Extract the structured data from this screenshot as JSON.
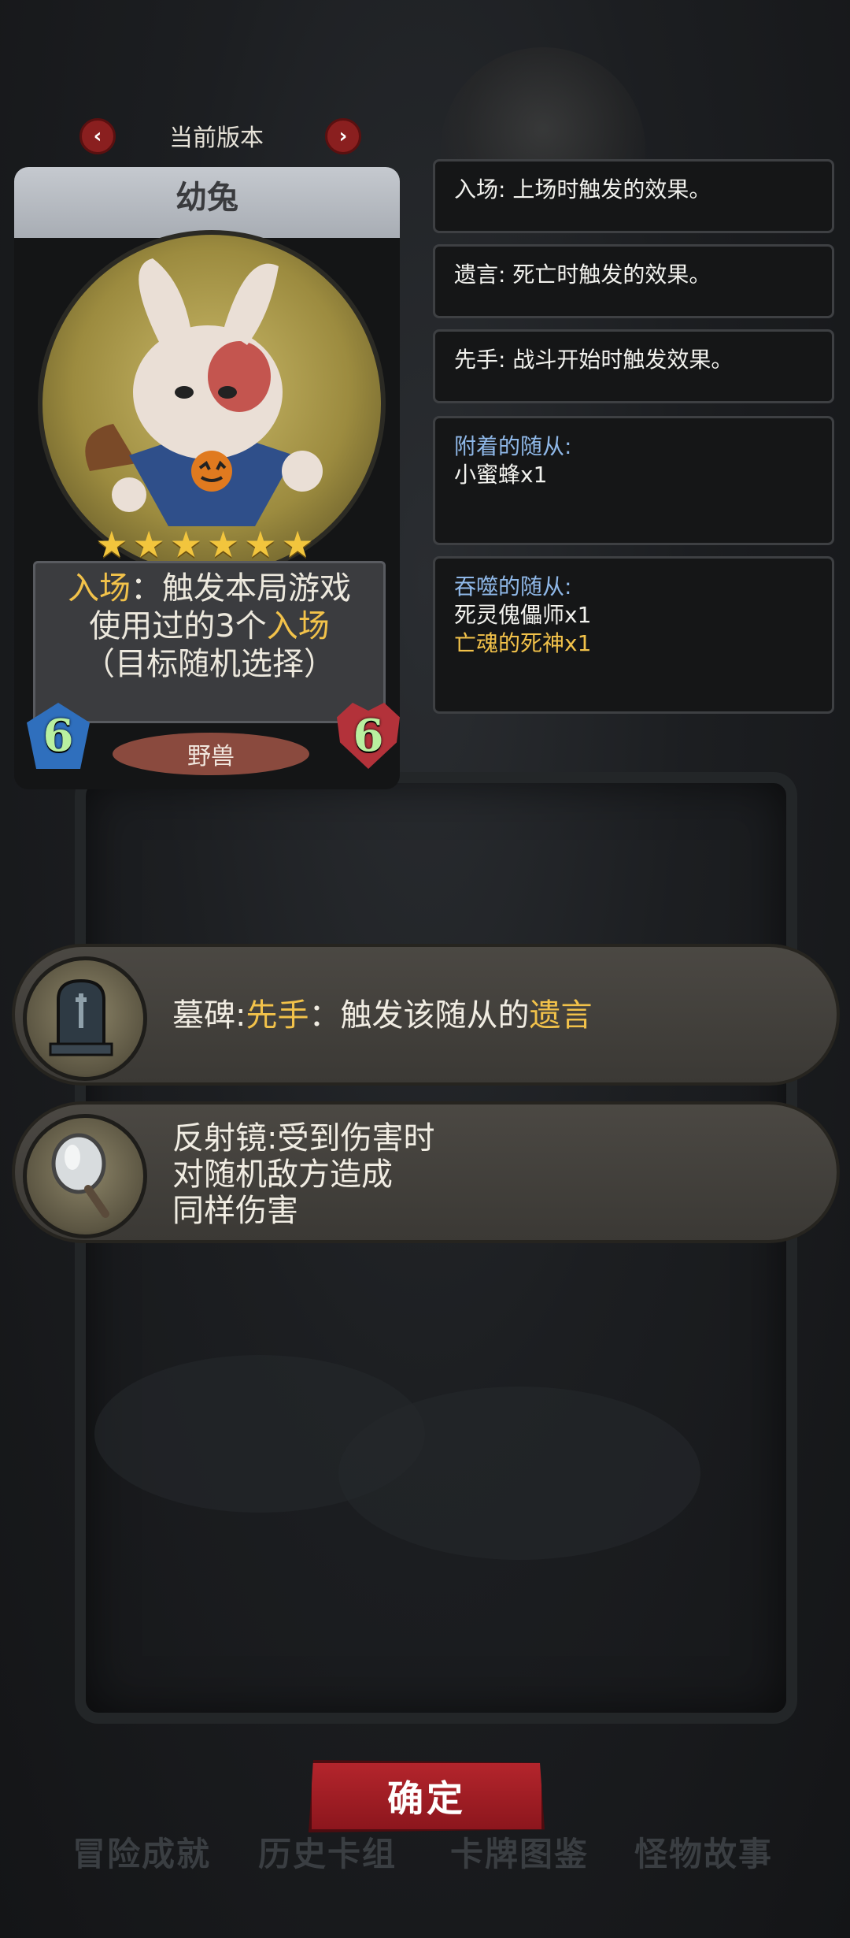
{
  "version_nav": {
    "title": "当前版本",
    "prev_symbol": "‹",
    "next_symbol": "›"
  },
  "card": {
    "name": "幼兔",
    "stars": "★★★★★★",
    "star_count": 6,
    "desc": {
      "line1_kw": "入场",
      "line1_rest": "：触发本局游戏",
      "line2_pre": "使用过的3个",
      "line2_kw": "入场",
      "line3": "（目标随机选择）"
    },
    "attack": "6",
    "health": "6",
    "tribe": "野兽"
  },
  "keywords": [
    {
      "text": "入场: 上场时触发的效果。"
    },
    {
      "text": "遗言: 死亡时触发的效果。"
    },
    {
      "text": "先手: 战斗开始时触发效果。"
    }
  ],
  "attached": {
    "title": "附着的随从:",
    "items": [
      "小蜜蜂x1"
    ]
  },
  "devoured": {
    "title": "吞噬的随从:",
    "items": [
      "死灵傀儡师x1",
      "亡魂的死神x1"
    ]
  },
  "relics": [
    {
      "icon": "tombstone-icon",
      "name": "墓碑:",
      "kw1": "先手",
      "mid": "：触发该随从的",
      "kw2": "遗言"
    },
    {
      "icon": "mirror-icon",
      "lines": [
        "反射镜:受到伤害时",
        "对随机敌方造成",
        "同样伤害"
      ]
    }
  ],
  "confirm_label": "确定",
  "bottom_tabs": [
    "冒险成就",
    "历史卡组",
    "卡牌图鉴",
    "怪物故事"
  ]
}
